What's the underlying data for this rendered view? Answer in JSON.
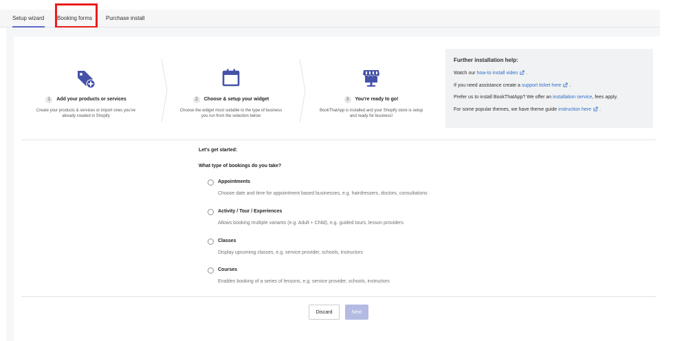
{
  "tabs": [
    {
      "label": "Setup wizard",
      "active": true
    },
    {
      "label": "Booking forms",
      "active": false
    },
    {
      "label": "Purchase install",
      "active": false
    }
  ],
  "colors": {
    "accent": "#5c6ac4",
    "icon": "#4552a8",
    "link": "#2c6ecb",
    "highlight": "#ea1a1a",
    "next_disabled": "#b4bbe3"
  },
  "steps": [
    {
      "number": "1",
      "title": "Add your products or services",
      "desc_line1": "Create your products & services or import ones you've",
      "desc_line2": "already created in Shopify",
      "icon": "tag-plus-icon"
    },
    {
      "number": "2",
      "title": "Choose & setup your widget",
      "desc_line1": "Choose the widget most suitable to the type of business",
      "desc_line2": "you run from the selection below",
      "icon": "calendar-icon"
    },
    {
      "number": "3",
      "title": "You're ready to go!",
      "desc_line1": "BookThatApp is installed and your Shopify store is setup",
      "desc_line2": "and ready for business!",
      "icon": "storefront-icon"
    }
  ],
  "help": {
    "title": "Further installation help:",
    "row1_pre": "Watch our ",
    "row1_link": "how-to install video",
    "row1_post": " .",
    "row2_pre": "If you need assistance create a ",
    "row2_link": "support ticket here",
    "row2_post": " .",
    "row3_pre": "Prefer us to install BookThatApp? We offer an ",
    "row3_link": "installation service",
    "row3_post": ", fees apply.",
    "row4_pre": "For some popular themes, we have theme guide ",
    "row4_link": "instruction here",
    "row4_post": " ."
  },
  "intro": "Let's get started:",
  "question": "What type of bookings do you take?",
  "options": [
    {
      "label": "Appointments",
      "desc": "Choose date and time for appointment based businesses, e.g. hairdressers, doctors, consultations"
    },
    {
      "label": "Activity / Tour / Experiences",
      "desc": "Allows booking multiple variants (e.g. Adult + Child), e.g. guided tours, lesson providers"
    },
    {
      "label": "Classes",
      "desc": "Display upcoming classes, e.g. service provider, schools, instructors"
    },
    {
      "label": "Courses",
      "desc": "Enables booking of a series of lessons, e.g. service provider, schools, instructors"
    }
  ],
  "buttons": {
    "discard": "Discard",
    "next": "Next"
  }
}
